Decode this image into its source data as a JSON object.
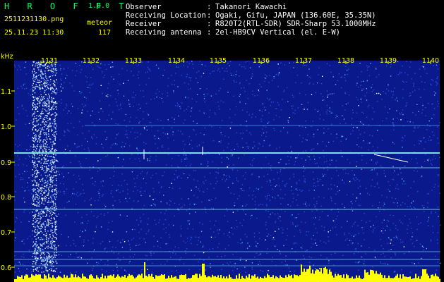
{
  "app": {
    "name": "H R O F F T",
    "version": "1.0.0"
  },
  "file": {
    "filename": "2511231130.png",
    "datetime": "25.11.23 11:30"
  },
  "meteor": {
    "label": "meteor",
    "count": "117"
  },
  "info": {
    "rows": [
      {
        "label": "Observer",
        "value": "Takanori Kawachi"
      },
      {
        "label": "Receiving Location",
        "value": "Ogaki, Gifu, JAPAN (136.60E, 35.35N)"
      },
      {
        "label": "Receiver",
        "value": "R820T2(RTL-SDR) SDR-Sharp 53.1000MHz"
      },
      {
        "label": "Receiving antenna",
        "value": "2el-HB9CV Vertical (el. E-W)"
      }
    ],
    "separator": ":"
  },
  "axis": {
    "unit": "kHz",
    "time_ticks": [
      "1131",
      "1132",
      "1133",
      "1134",
      "1135",
      "1136",
      "1137",
      "1138",
      "1139",
      "1140"
    ],
    "freq_ticks": [
      "1.1",
      "1.0",
      "0.9",
      "0.8",
      "0.7",
      "0.6"
    ]
  },
  "colors": {
    "background": "#0a1a8c",
    "noise": "#2a4cd6",
    "carrier": "#7fe0e0",
    "labels": "#ffff00",
    "logo": "#00ff66",
    "activity": "#ffff00"
  }
}
